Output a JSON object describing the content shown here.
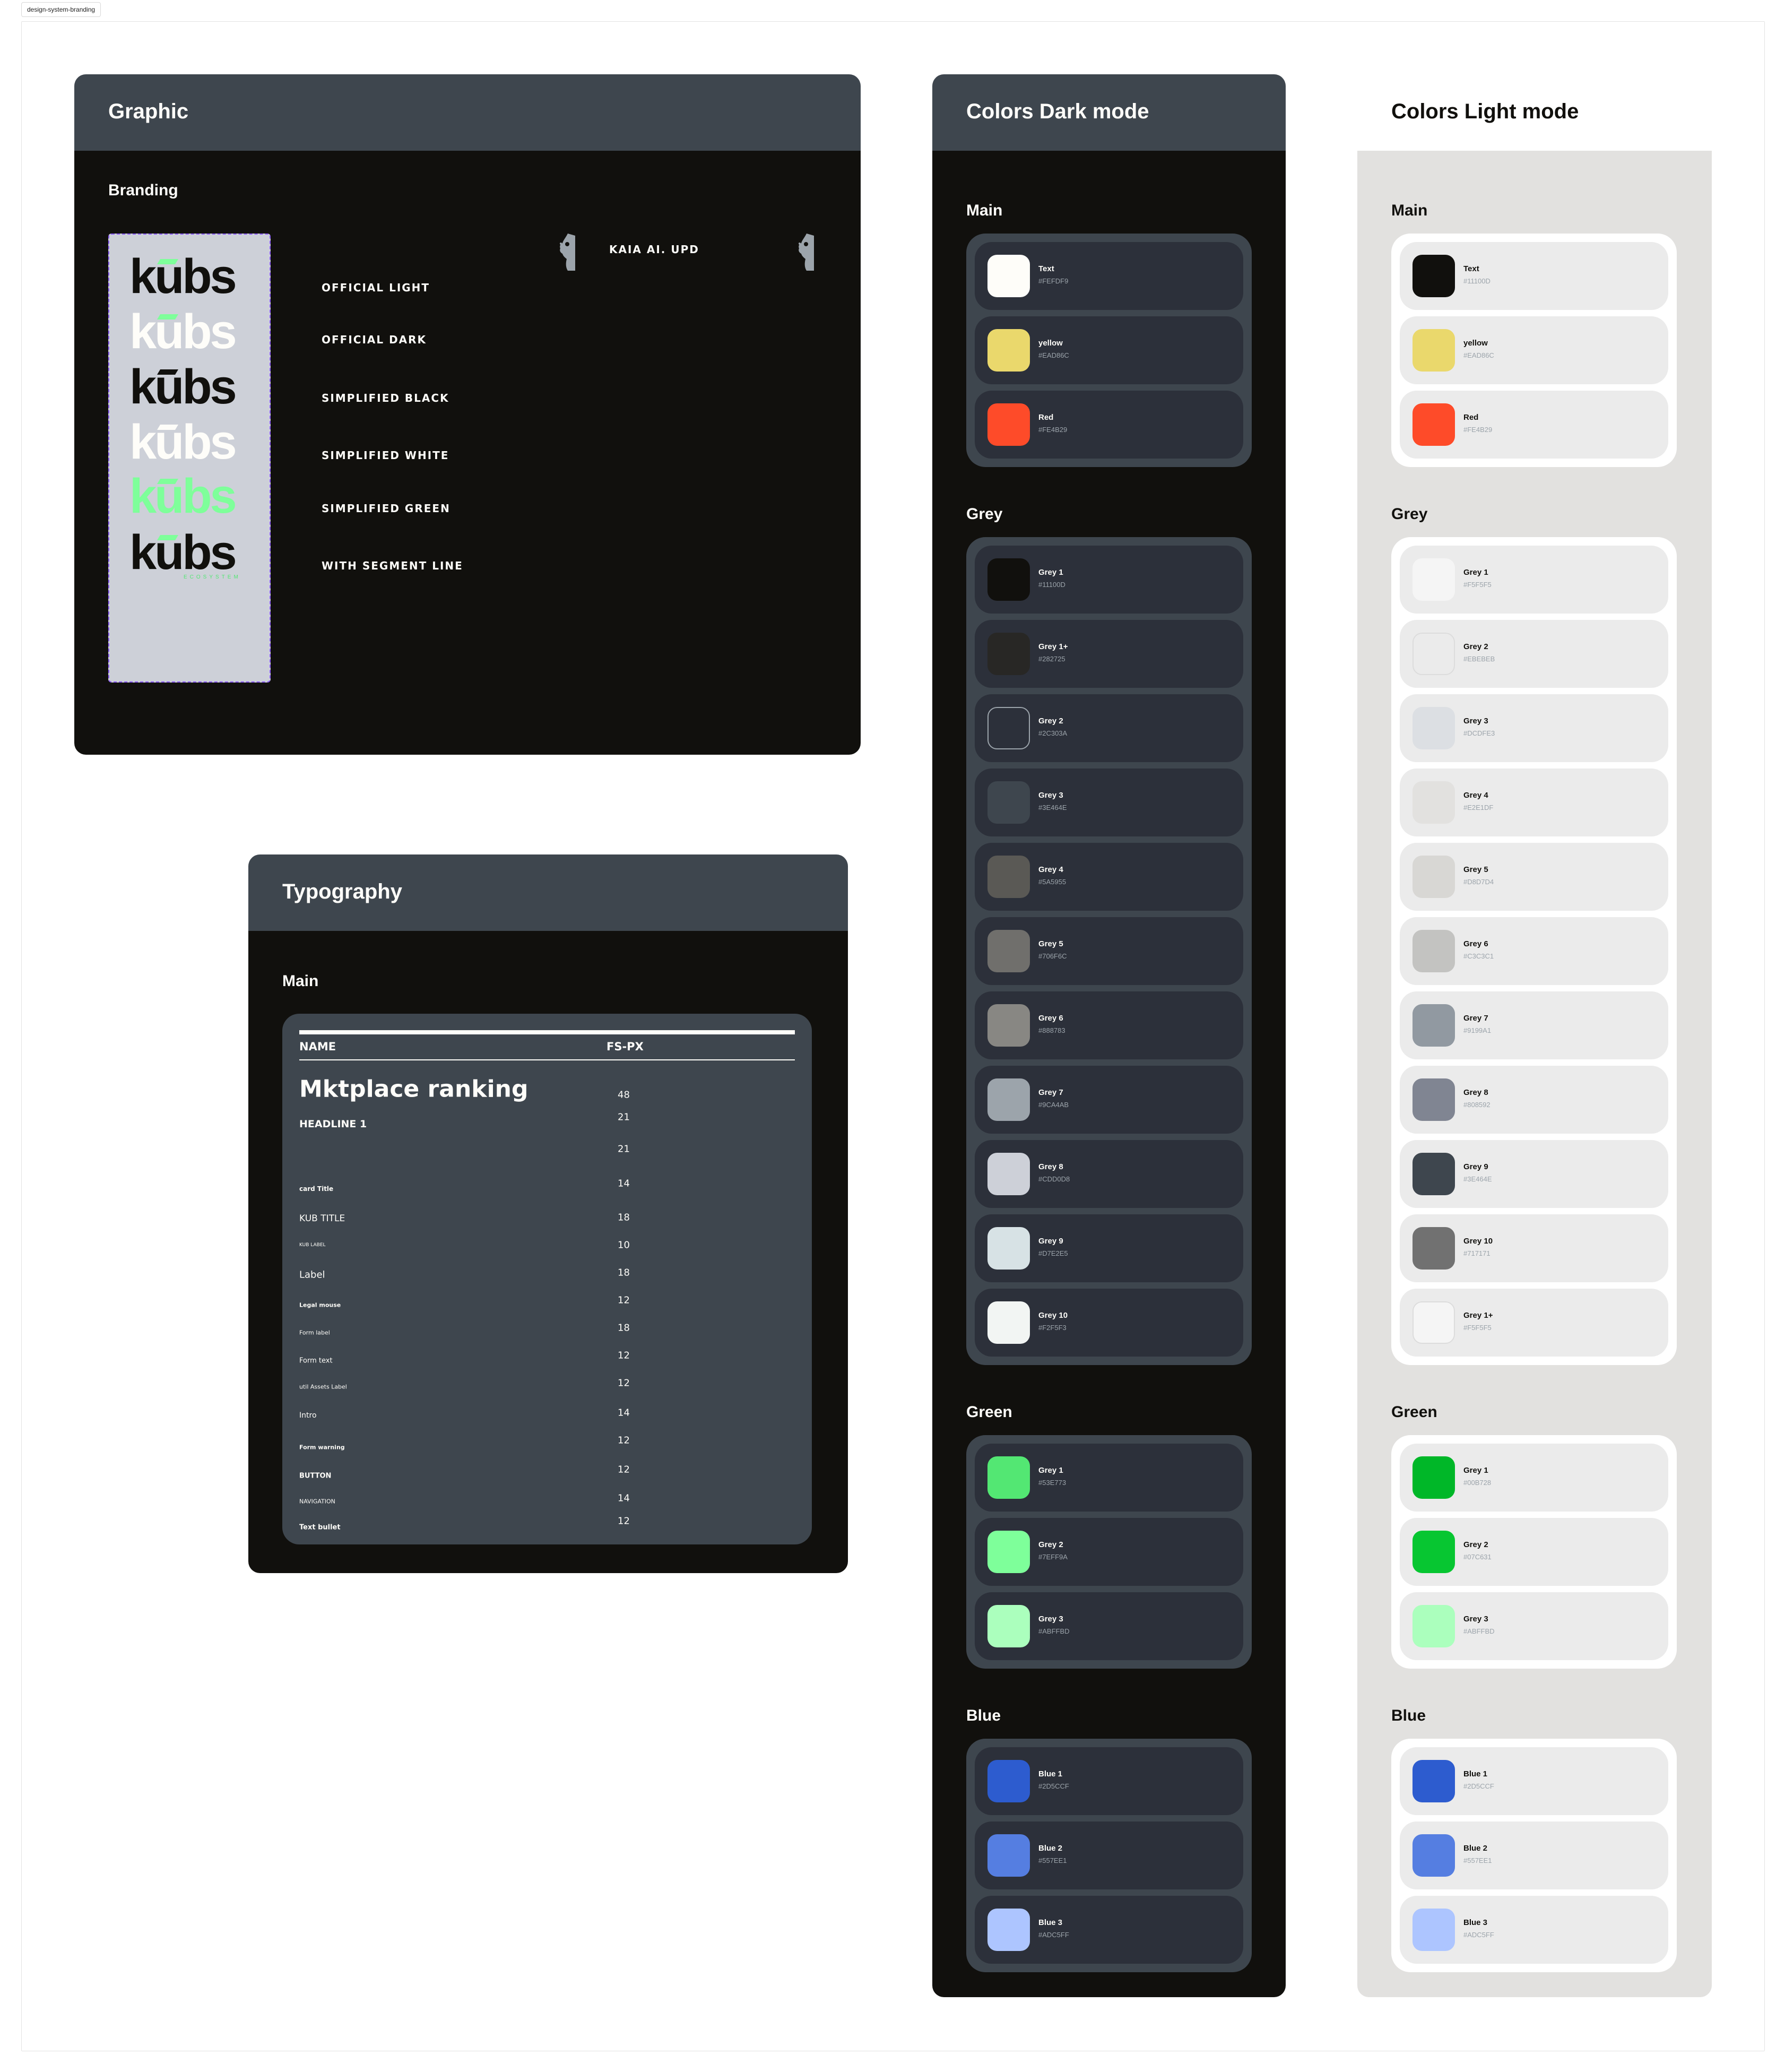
{
  "frame": {
    "label": "design-system-branding"
  },
  "graphic": {
    "title": "Graphic",
    "section": "Branding",
    "logos": [
      {
        "label": "OFFICIAL LIGHT",
        "wordmark": "kubs",
        "text_color": "#11100d",
        "accent": "#7eff9a",
        "sub": ""
      },
      {
        "label": "OFFICIAL DARK",
        "wordmark": "kubs",
        "text_color": "#fefdf9",
        "accent": "#7eff9a",
        "sub": ""
      },
      {
        "label": "SIMPLIFIED BLACK",
        "wordmark": "kubs",
        "text_color": "#11100d",
        "accent": "#11100d",
        "sub": ""
      },
      {
        "label": "SIMPLIFIED WHITE",
        "wordmark": "kubs",
        "text_color": "#fefdf9",
        "accent": "#fefdf9",
        "sub": ""
      },
      {
        "label": "SIMPLIFIED GREEN",
        "wordmark": "kubs",
        "text_color": "#7eff9a",
        "accent": "#7eff9a",
        "sub": ""
      },
      {
        "label": "WITH SEGMENT LINE",
        "wordmark": "kubs",
        "text_color": "#11100d",
        "accent": "#7eff9a",
        "sub": "ECOSYSTEM"
      }
    ],
    "kaia_label": "KAIA AI. UPD",
    "icons": [
      "face-icon",
      "face-icon"
    ]
  },
  "typography": {
    "title": "Typography",
    "section": "Main",
    "columns": [
      "NAME",
      "FS-PX"
    ],
    "rows": [
      {
        "name": "Mktplace ranking",
        "size": "48"
      },
      {
        "name": "HEADLINE 1",
        "size": "21"
      },
      {
        "name": "",
        "size": "21"
      },
      {
        "name": "card Title",
        "size": "14"
      },
      {
        "name": "KUB TITLE",
        "size": "18"
      },
      {
        "name": "KUB LABEL",
        "size": "10"
      },
      {
        "name": "Label",
        "size": "18"
      },
      {
        "name": "Legal mouse",
        "size": "12"
      },
      {
        "name": "Form label",
        "size": "18"
      },
      {
        "name": "Form text",
        "size": "12"
      },
      {
        "name": "util Assets Label",
        "size": "12"
      },
      {
        "name": "Intro",
        "size": "14"
      },
      {
        "name": "Form warning",
        "size": "12"
      },
      {
        "name": "BUTTON",
        "size": "12"
      },
      {
        "name": "NAVIGATION",
        "size": "14"
      },
      {
        "name": "Text bullet",
        "size": "12"
      }
    ]
  },
  "colors_dark": {
    "title": "Colors Dark mode",
    "groups": [
      {
        "title": "Main",
        "swatches": [
          {
            "name": "Text",
            "hex": "#FEFDF9"
          },
          {
            "name": "yellow",
            "hex": "#EAD86C"
          },
          {
            "name": "Red",
            "hex": "#FE4B29"
          }
        ]
      },
      {
        "title": "Grey",
        "swatches": [
          {
            "name": "Grey 1",
            "hex": "#11100D"
          },
          {
            "name": "Grey 1+",
            "hex": "#282725"
          },
          {
            "name": "Grey 2",
            "hex": "#2C303A"
          },
          {
            "name": "Grey 3",
            "hex": "#3E464E"
          },
          {
            "name": "Grey 4",
            "hex": "#5A5955"
          },
          {
            "name": "Grey 5",
            "hex": "#706F6C"
          },
          {
            "name": "Grey 6",
            "hex": "#888783"
          },
          {
            "name": "Grey 7",
            "hex": "#9CA4AB"
          },
          {
            "name": "Grey 8",
            "hex": "#CDD0D8"
          },
          {
            "name": "Grey 9",
            "hex": "#D7E2E5"
          },
          {
            "name": "Grey 10",
            "hex": "#F2F5F3"
          }
        ]
      },
      {
        "title": "Green",
        "swatches": [
          {
            "name": "Grey 1",
            "hex": "#53E773"
          },
          {
            "name": "Grey 2",
            "hex": "#7EFF9A"
          },
          {
            "name": "Grey 3",
            "hex": "#ABFFBD"
          }
        ]
      },
      {
        "title": "Blue",
        "swatches": [
          {
            "name": "Blue 1",
            "hex": "#2D5CCF"
          },
          {
            "name": "Blue 2",
            "hex": "#557EE1"
          },
          {
            "name": "Blue 3",
            "hex": "#ADC5FF"
          }
        ]
      }
    ]
  },
  "colors_light": {
    "title": "Colors Light mode",
    "groups": [
      {
        "title": "Main",
        "swatches": [
          {
            "name": "Text",
            "hex": "#11100D"
          },
          {
            "name": "yellow",
            "hex": "#EAD86C"
          },
          {
            "name": "Red",
            "hex": "#FE4B29"
          }
        ]
      },
      {
        "title": "Grey",
        "swatches": [
          {
            "name": "Grey 1",
            "hex": "#F5F5F5"
          },
          {
            "name": "Grey 2",
            "hex": "#EBEBEB"
          },
          {
            "name": "Grey 3",
            "hex": "#DCDFE3"
          },
          {
            "name": "Grey 4",
            "hex": "#E2E1DF"
          },
          {
            "name": "Grey 5",
            "hex": "#D8D7D4"
          },
          {
            "name": "Grey 6",
            "hex": "#C3C3C1"
          },
          {
            "name": "Grey 7",
            "hex": "#9199A1"
          },
          {
            "name": "Grey 8",
            "hex": "#808592"
          },
          {
            "name": "Grey 9",
            "hex": "#3E464E"
          },
          {
            "name": "Grey 10",
            "hex": "#717171"
          },
          {
            "name": "Grey 1+",
            "hex": "#F5F5F5"
          }
        ]
      },
      {
        "title": "Green",
        "swatches": [
          {
            "name": "Grey 1",
            "hex": "#00B728"
          },
          {
            "name": "Grey 2",
            "hex": "#07C631"
          },
          {
            "name": "Grey 3",
            "hex": "#ABFFBD"
          }
        ]
      },
      {
        "title": "Blue",
        "swatches": [
          {
            "name": "Blue 1",
            "hex": "#2D5CCF"
          },
          {
            "name": "Blue 2",
            "hex": "#557EE1"
          },
          {
            "name": "Blue 3",
            "hex": "#ADC5FF"
          }
        ]
      }
    ]
  }
}
